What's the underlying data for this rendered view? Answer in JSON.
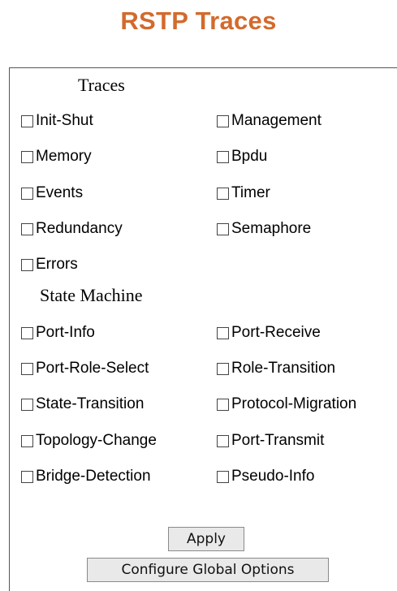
{
  "title": "RSTP Traces",
  "traces": {
    "heading": "Traces",
    "left": [
      {
        "label": "Init-Shut",
        "checked": false
      },
      {
        "label": "Memory",
        "checked": false
      },
      {
        "label": "Events",
        "checked": false
      },
      {
        "label": "Redundancy",
        "checked": false
      },
      {
        "label": "Errors",
        "checked": false
      }
    ],
    "right": [
      {
        "label": "Management",
        "checked": false
      },
      {
        "label": "Bpdu",
        "checked": false
      },
      {
        "label": "Timer",
        "checked": false
      },
      {
        "label": "Semaphore",
        "checked": false
      }
    ]
  },
  "state_machine": {
    "heading": "State Machine",
    "left": [
      {
        "label": "Port-Info",
        "checked": false
      },
      {
        "label": "Port-Role-Select",
        "checked": false
      },
      {
        "label": "State-Transition",
        "checked": false
      },
      {
        "label": "Topology-Change",
        "checked": false
      },
      {
        "label": "Bridge-Detection",
        "checked": false
      }
    ],
    "right": [
      {
        "label": "Port-Receive",
        "checked": false
      },
      {
        "label": "Role-Transition",
        "checked": false
      },
      {
        "label": "Protocol-Migration",
        "checked": false
      },
      {
        "label": "Port-Transmit",
        "checked": false
      },
      {
        "label": "Pseudo-Info",
        "checked": false
      }
    ]
  },
  "buttons": {
    "apply": "Apply",
    "configure_global": "Configure Global Options"
  }
}
